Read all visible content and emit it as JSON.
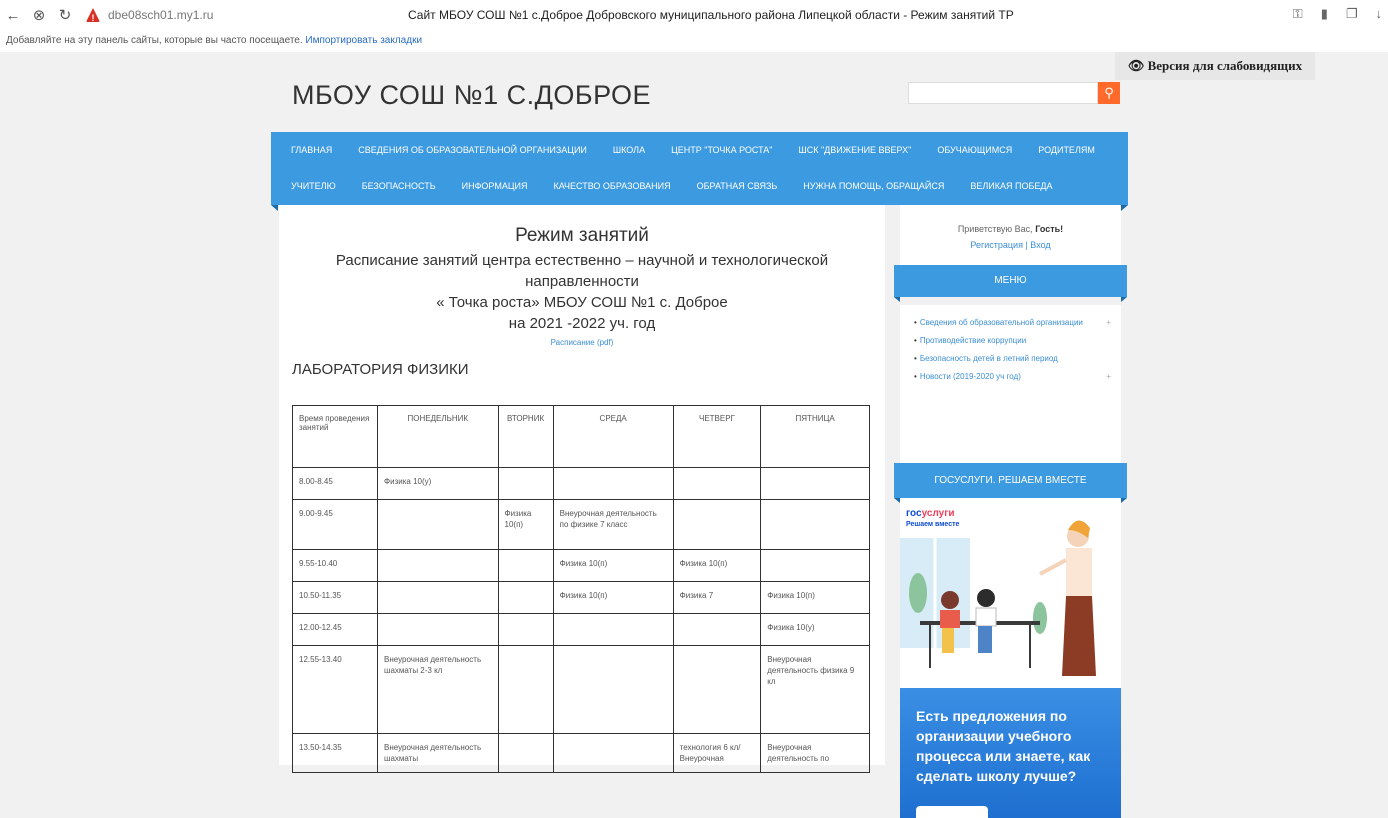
{
  "browser": {
    "url": "dbe08sch01.my1.ru",
    "tab_title": "Сайт МБОУ СОШ №1 с.Доброе Добровского муниципального района Липецкой области - Режим занятий ТР",
    "bookmarks_text": "Добавляйте на эту панель сайты, которые вы часто посещаете.",
    "bookmarks_link": "Импортировать закладки",
    "icons": [
      "back-icon",
      "block-icon",
      "reload-icon",
      "warning-icon",
      "key-icon",
      "bookmark-icon",
      "sidebar-icon",
      "download-icon"
    ]
  },
  "header": {
    "a11y": "👁 Версия для слабовидящих",
    "site_title": "МБОУ СОШ №1 С.ДОБРОЕ",
    "search_placeholder": ""
  },
  "menu": {
    "row1": [
      "Главная",
      "Сведения об образовательной организации",
      "Школа",
      "Центр \"Точка роста\"",
      "ШСК \"Движение вверх\"",
      "Обучающимся",
      "Родителям"
    ],
    "row2": [
      "Учителю",
      "Безопасность",
      "Информация",
      "Качество образования",
      "Обратная связь",
      "Нужна помощь, обращайся",
      "Великая Победа"
    ]
  },
  "content": {
    "title": "Режим занятий",
    "subtitle_1": "Расписание занятий центра естественно – научной и технологической",
    "subtitle_2": "направленности",
    "subtitle_3": "« Точка роста» МБОУ СОШ №1 с. Доброе",
    "subtitle_4": "на 2021 -2022 уч. год",
    "pdf_link": "Расписание (pdf)",
    "lab_title": "ЛАБОРАТОРИЯ ФИЗИКИ",
    "table": {
      "headers": [
        "Время проведения занятий",
        "Понедельник",
        "Вторник",
        "Среда",
        "Четверг",
        "Пятница"
      ],
      "rows": [
        [
          "8.00-8.45",
          "Физика 10(у)",
          "",
          "",
          "",
          ""
        ],
        [
          "9.00-9.45",
          "",
          "Физика 10(п)",
          "Внеурочная деятельность по физике 7 класс",
          "",
          ""
        ],
        [
          "9.55-10.40",
          "",
          "",
          "Физика 10(п)",
          "Физика 10(п)",
          ""
        ],
        [
          "10.50-11.35",
          "",
          "",
          "Физика 10(п)",
          "Физика 7",
          "Физика 10(п)"
        ],
        [
          "12.00-12.45",
          "",
          "",
          "",
          "",
          "Физика 10(у)"
        ],
        [
          "12.55-13.40",
          "Внеурочная деятельность шахматы 2-3 кл",
          "",
          "",
          "",
          "Внеурочная деятельность физика 9 кл"
        ],
        [
          "13.50-14.35",
          "Внеурочная деятельность шахматы",
          "",
          "",
          "технология 6 кл/ Внеурочная",
          "Внеурочная деятельность по"
        ]
      ]
    }
  },
  "sidebar": {
    "greeting": "Приветствую Вас,",
    "guest": "Гость!",
    "auth_links": "Регистрация | Вход",
    "menu_title": "Меню",
    "menu_items": [
      {
        "label": "Сведения об образовательной организации",
        "plus": "+"
      },
      {
        "label": "Противодействие коррупции",
        "plus": ""
      },
      {
        "label": "Безопасность детей в летний период",
        "plus": ""
      },
      {
        "label": "Новости (2019-2020 уч год)",
        "plus": "+"
      }
    ],
    "gos_title": "Госуслуги. Решаем вместе",
    "gos_logo_a": "гос",
    "gos_logo_b": "услуги",
    "gos_sub": "Решаем вместе",
    "promo_text": "Есть предложения по организации учебного процесса или знаете, как сделать школу лучше?"
  }
}
